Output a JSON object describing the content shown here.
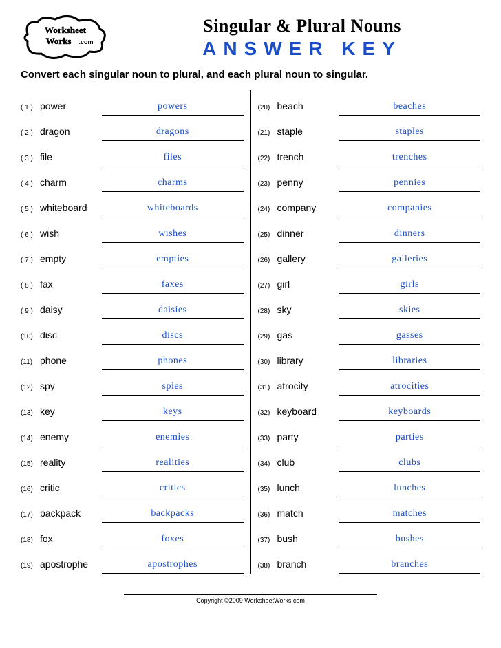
{
  "header": {
    "logo_text": "WorksheetWorks.com",
    "title": "Singular & Plural Nouns",
    "subtitle": "ANSWER KEY"
  },
  "instructions": "Convert each singular noun to plural, and each plural noun to singular.",
  "left": [
    {
      "n": "( 1 )",
      "word": "power",
      "ans": "powers"
    },
    {
      "n": "( 2 )",
      "word": "dragon",
      "ans": "dragons"
    },
    {
      "n": "( 3 )",
      "word": "file",
      "ans": "files"
    },
    {
      "n": "( 4 )",
      "word": "charm",
      "ans": "charms"
    },
    {
      "n": "( 5 )",
      "word": "whiteboard",
      "ans": "whiteboards"
    },
    {
      "n": "( 6 )",
      "word": "wish",
      "ans": "wishes"
    },
    {
      "n": "( 7 )",
      "word": "empty",
      "ans": "empties"
    },
    {
      "n": "( 8 )",
      "word": "fax",
      "ans": "faxes"
    },
    {
      "n": "( 9 )",
      "word": "daisy",
      "ans": "daisies"
    },
    {
      "n": "(10)",
      "word": "disc",
      "ans": "discs"
    },
    {
      "n": "(11)",
      "word": "phone",
      "ans": "phones"
    },
    {
      "n": "(12)",
      "word": "spy",
      "ans": "spies"
    },
    {
      "n": "(13)",
      "word": "key",
      "ans": "keys"
    },
    {
      "n": "(14)",
      "word": "enemy",
      "ans": "enemies"
    },
    {
      "n": "(15)",
      "word": "reality",
      "ans": "realities"
    },
    {
      "n": "(16)",
      "word": "critic",
      "ans": "critics"
    },
    {
      "n": "(17)",
      "word": "backpack",
      "ans": "backpacks"
    },
    {
      "n": "(18)",
      "word": "fox",
      "ans": "foxes"
    },
    {
      "n": "(19)",
      "word": "apostrophe",
      "ans": "apostrophes"
    }
  ],
  "right": [
    {
      "n": "(20)",
      "word": "beach",
      "ans": "beaches"
    },
    {
      "n": "(21)",
      "word": "staple",
      "ans": "staples"
    },
    {
      "n": "(22)",
      "word": "trench",
      "ans": "trenches"
    },
    {
      "n": "(23)",
      "word": "penny",
      "ans": "pennies"
    },
    {
      "n": "(24)",
      "word": "company",
      "ans": "companies"
    },
    {
      "n": "(25)",
      "word": "dinner",
      "ans": "dinners"
    },
    {
      "n": "(26)",
      "word": "gallery",
      "ans": "galleries"
    },
    {
      "n": "(27)",
      "word": "girl",
      "ans": "girls"
    },
    {
      "n": "(28)",
      "word": "sky",
      "ans": "skies"
    },
    {
      "n": "(29)",
      "word": "gas",
      "ans": "gasses"
    },
    {
      "n": "(30)",
      "word": "library",
      "ans": "libraries"
    },
    {
      "n": "(31)",
      "word": "atrocity",
      "ans": "atrocities"
    },
    {
      "n": "(32)",
      "word": "keyboard",
      "ans": "keyboards"
    },
    {
      "n": "(33)",
      "word": "party",
      "ans": "parties"
    },
    {
      "n": "(34)",
      "word": "club",
      "ans": "clubs"
    },
    {
      "n": "(35)",
      "word": "lunch",
      "ans": "lunches"
    },
    {
      "n": "(36)",
      "word": "match",
      "ans": "matches"
    },
    {
      "n": "(37)",
      "word": "bush",
      "ans": "bushes"
    },
    {
      "n": "(38)",
      "word": "branch",
      "ans": "branches"
    }
  ],
  "copyright": "Copyright ©2009 WorksheetWorks.com"
}
